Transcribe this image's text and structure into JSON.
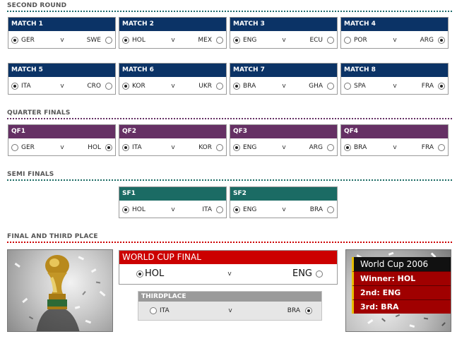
{
  "sections": {
    "second_round": "SECOND ROUND",
    "quarter_finals": "QUARTER FINALS",
    "semi_finals": "SEMI FINALS",
    "final_third": "FINAL AND THIRD PLACE"
  },
  "versus": "v",
  "second_round": [
    {
      "label": "MATCH 1",
      "team_a": "GER",
      "team_b": "SWE",
      "selected": "a"
    },
    {
      "label": "MATCH 2",
      "team_a": "HOL",
      "team_b": "MEX",
      "selected": "a"
    },
    {
      "label": "MATCH 3",
      "team_a": "ENG",
      "team_b": "ECU",
      "selected": "a"
    },
    {
      "label": "MATCH 4",
      "team_a": "POR",
      "team_b": "ARG",
      "selected": "b"
    },
    {
      "label": "MATCH 5",
      "team_a": "ITA",
      "team_b": "CRO",
      "selected": "a"
    },
    {
      "label": "MATCH 6",
      "team_a": "KOR",
      "team_b": "UKR",
      "selected": "a"
    },
    {
      "label": "MATCH 7",
      "team_a": "BRA",
      "team_b": "GHA",
      "selected": "a"
    },
    {
      "label": "MATCH 8",
      "team_a": "SPA",
      "team_b": "FRA",
      "selected": "b"
    }
  ],
  "quarter_finals": [
    {
      "label": "QF1",
      "team_a": "GER",
      "team_b": "HOL",
      "selected": "b"
    },
    {
      "label": "QF2",
      "team_a": "ITA",
      "team_b": "KOR",
      "selected": "a"
    },
    {
      "label": "QF3",
      "team_a": "ENG",
      "team_b": "ARG",
      "selected": "a"
    },
    {
      "label": "QF4",
      "team_a": "BRA",
      "team_b": "FRA",
      "selected": "a"
    }
  ],
  "semi_finals": [
    {
      "label": "SF1",
      "team_a": "HOL",
      "team_b": "ITA",
      "selected": "a"
    },
    {
      "label": "SF2",
      "team_a": "ENG",
      "team_b": "BRA",
      "selected": "a"
    }
  ],
  "final": {
    "label": "WORLD CUP FINAL",
    "team_a": "HOL",
    "team_b": "ENG",
    "selected": "a"
  },
  "third_place": {
    "label": "THIRDPLACE",
    "team_a": "ITA",
    "team_b": "BRA",
    "selected": "b"
  },
  "summary": {
    "title": "World Cup 2006",
    "winner": "Winner: HOL",
    "second": "2nd: ENG",
    "third": "3rd: BRA"
  },
  "colors": {
    "second_round": "#0b3366",
    "quarter_finals": "#653064",
    "semi_finals": "#1b6b64",
    "final": "#cc0000",
    "third_place": "#9a9a9a"
  },
  "icons": {
    "left_image": "trophy-photo",
    "right_image": "celebration-photo"
  }
}
